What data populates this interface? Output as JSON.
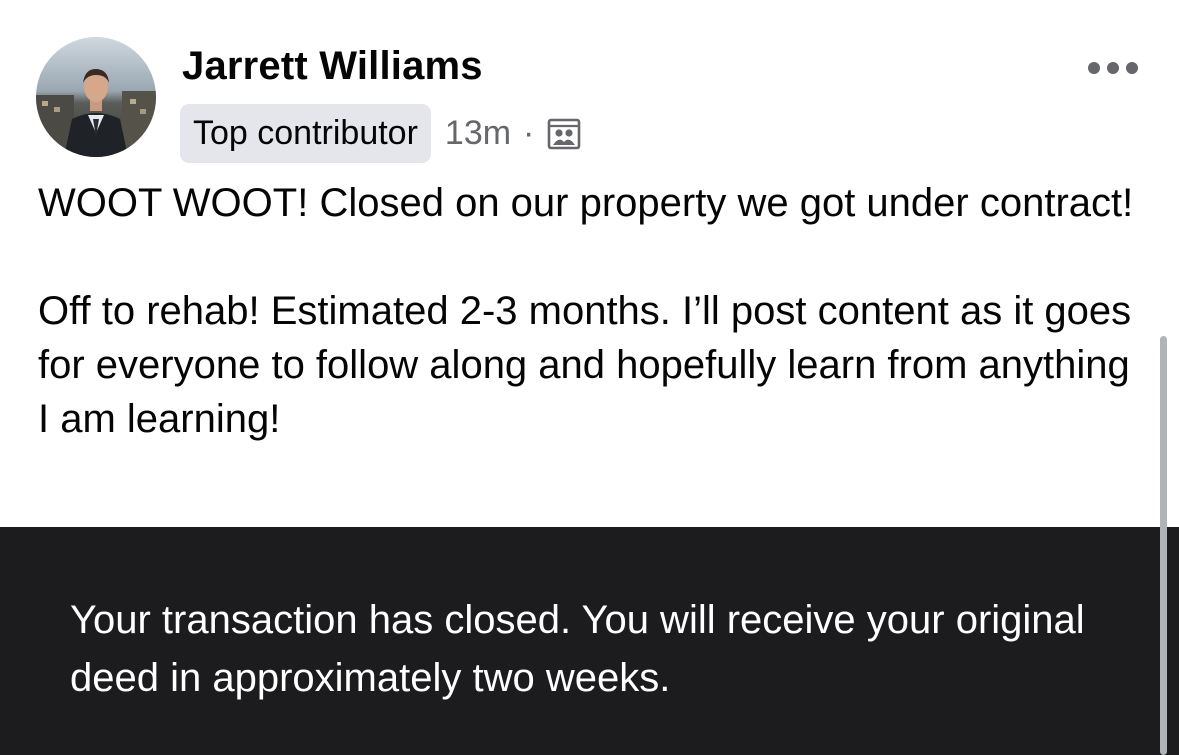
{
  "post": {
    "author_name": "Jarrett Williams",
    "badge": "Top contributor",
    "timestamp": "13m",
    "separator": "·",
    "audience_icon": "group-audience-icon",
    "more_icon": "more-options-icon",
    "paragraphs": [
      "WOOT WOOT! Closed on our property we got under contract!",
      "Off to rehab! Estimated 2-3 months. I’ll post content as it goes for everyone to follow along and hopefully learn from anything I am learning!"
    ]
  },
  "image_caption": {
    "text": "Your transaction has closed.  You will receive your original deed in approximately two weeks."
  },
  "colors": {
    "primary_text": "#050505",
    "secondary_text": "#65676b",
    "badge_background": "#e4e6eb",
    "dark_panel": "#1c1c1e",
    "panel_text": "#ffffff"
  }
}
